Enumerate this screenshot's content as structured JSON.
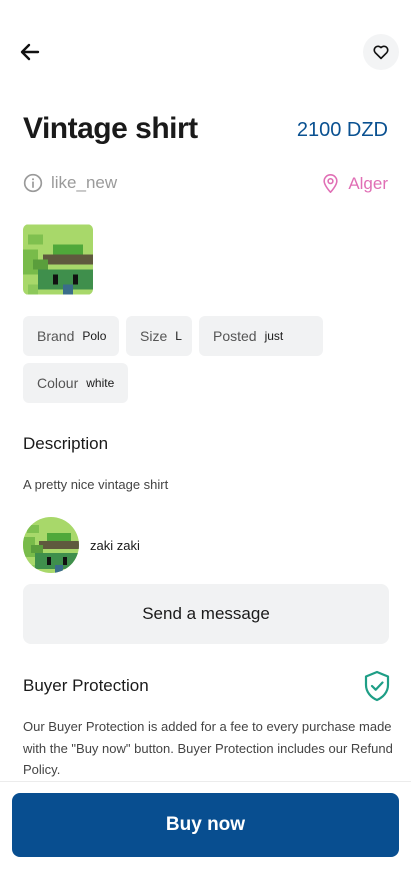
{
  "header": {
    "back_icon": "arrow-left-icon",
    "favorite_icon": "heart-outline-icon"
  },
  "product": {
    "title": "Vintage shirt",
    "price": "2100 DZD",
    "condition": "like_new",
    "condition_icon": "info-circle-icon",
    "location": "Alger",
    "location_icon": "map-pin-icon"
  },
  "attributes": [
    {
      "key": "Brand",
      "value": "Polo"
    },
    {
      "key": "Size",
      "value": "L"
    },
    {
      "key": "Posted",
      "value": "just"
    },
    {
      "key": "Colour",
      "value": "white"
    }
  ],
  "description": {
    "heading": "Description",
    "text": "A pretty nice vintage shirt"
  },
  "seller": {
    "name": "zaki zaki"
  },
  "message_button": "Send a message",
  "buyer_protection": {
    "heading": "Buyer Protection",
    "icon": "shield-check-icon",
    "text": "Our Buyer Protection is added for a fee to every purchase made with the \"Buy now\" button. Buyer Protection includes our Refund Policy."
  },
  "buy_button": "Buy now",
  "colors": {
    "price": "#0a5191",
    "location": "#e06fb5",
    "primary_button": "#084e90",
    "shield": "#1e9e86"
  }
}
